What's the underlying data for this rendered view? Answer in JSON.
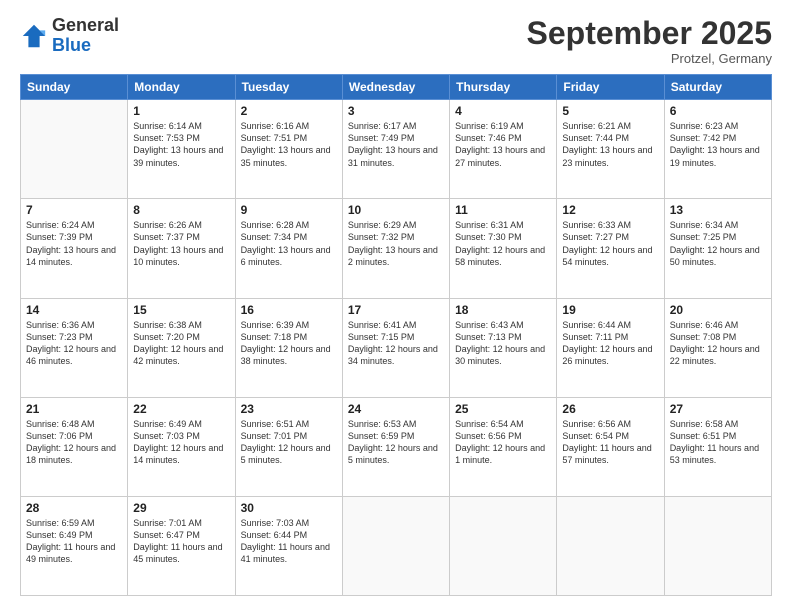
{
  "header": {
    "logo_general": "General",
    "logo_blue": "Blue",
    "month_title": "September 2025",
    "location": "Protzel, Germany"
  },
  "days_of_week": [
    "Sunday",
    "Monday",
    "Tuesday",
    "Wednesday",
    "Thursday",
    "Friday",
    "Saturday"
  ],
  "weeks": [
    [
      {
        "day": "",
        "sunrise": "",
        "sunset": "",
        "daylight": ""
      },
      {
        "day": "1",
        "sunrise": "Sunrise: 6:14 AM",
        "sunset": "Sunset: 7:53 PM",
        "daylight": "Daylight: 13 hours and 39 minutes."
      },
      {
        "day": "2",
        "sunrise": "Sunrise: 6:16 AM",
        "sunset": "Sunset: 7:51 PM",
        "daylight": "Daylight: 13 hours and 35 minutes."
      },
      {
        "day": "3",
        "sunrise": "Sunrise: 6:17 AM",
        "sunset": "Sunset: 7:49 PM",
        "daylight": "Daylight: 13 hours and 31 minutes."
      },
      {
        "day": "4",
        "sunrise": "Sunrise: 6:19 AM",
        "sunset": "Sunset: 7:46 PM",
        "daylight": "Daylight: 13 hours and 27 minutes."
      },
      {
        "day": "5",
        "sunrise": "Sunrise: 6:21 AM",
        "sunset": "Sunset: 7:44 PM",
        "daylight": "Daylight: 13 hours and 23 minutes."
      },
      {
        "day": "6",
        "sunrise": "Sunrise: 6:23 AM",
        "sunset": "Sunset: 7:42 PM",
        "daylight": "Daylight: 13 hours and 19 minutes."
      }
    ],
    [
      {
        "day": "7",
        "sunrise": "Sunrise: 6:24 AM",
        "sunset": "Sunset: 7:39 PM",
        "daylight": "Daylight: 13 hours and 14 minutes."
      },
      {
        "day": "8",
        "sunrise": "Sunrise: 6:26 AM",
        "sunset": "Sunset: 7:37 PM",
        "daylight": "Daylight: 13 hours and 10 minutes."
      },
      {
        "day": "9",
        "sunrise": "Sunrise: 6:28 AM",
        "sunset": "Sunset: 7:34 PM",
        "daylight": "Daylight: 13 hours and 6 minutes."
      },
      {
        "day": "10",
        "sunrise": "Sunrise: 6:29 AM",
        "sunset": "Sunset: 7:32 PM",
        "daylight": "Daylight: 13 hours and 2 minutes."
      },
      {
        "day": "11",
        "sunrise": "Sunrise: 6:31 AM",
        "sunset": "Sunset: 7:30 PM",
        "daylight": "Daylight: 12 hours and 58 minutes."
      },
      {
        "day": "12",
        "sunrise": "Sunrise: 6:33 AM",
        "sunset": "Sunset: 7:27 PM",
        "daylight": "Daylight: 12 hours and 54 minutes."
      },
      {
        "day": "13",
        "sunrise": "Sunrise: 6:34 AM",
        "sunset": "Sunset: 7:25 PM",
        "daylight": "Daylight: 12 hours and 50 minutes."
      }
    ],
    [
      {
        "day": "14",
        "sunrise": "Sunrise: 6:36 AM",
        "sunset": "Sunset: 7:23 PM",
        "daylight": "Daylight: 12 hours and 46 minutes."
      },
      {
        "day": "15",
        "sunrise": "Sunrise: 6:38 AM",
        "sunset": "Sunset: 7:20 PM",
        "daylight": "Daylight: 12 hours and 42 minutes."
      },
      {
        "day": "16",
        "sunrise": "Sunrise: 6:39 AM",
        "sunset": "Sunset: 7:18 PM",
        "daylight": "Daylight: 12 hours and 38 minutes."
      },
      {
        "day": "17",
        "sunrise": "Sunrise: 6:41 AM",
        "sunset": "Sunset: 7:15 PM",
        "daylight": "Daylight: 12 hours and 34 minutes."
      },
      {
        "day": "18",
        "sunrise": "Sunrise: 6:43 AM",
        "sunset": "Sunset: 7:13 PM",
        "daylight": "Daylight: 12 hours and 30 minutes."
      },
      {
        "day": "19",
        "sunrise": "Sunrise: 6:44 AM",
        "sunset": "Sunset: 7:11 PM",
        "daylight": "Daylight: 12 hours and 26 minutes."
      },
      {
        "day": "20",
        "sunrise": "Sunrise: 6:46 AM",
        "sunset": "Sunset: 7:08 PM",
        "daylight": "Daylight: 12 hours and 22 minutes."
      }
    ],
    [
      {
        "day": "21",
        "sunrise": "Sunrise: 6:48 AM",
        "sunset": "Sunset: 7:06 PM",
        "daylight": "Daylight: 12 hours and 18 minutes."
      },
      {
        "day": "22",
        "sunrise": "Sunrise: 6:49 AM",
        "sunset": "Sunset: 7:03 PM",
        "daylight": "Daylight: 12 hours and 14 minutes."
      },
      {
        "day": "23",
        "sunrise": "Sunrise: 6:51 AM",
        "sunset": "Sunset: 7:01 PM",
        "daylight": "Daylight: 12 hours and 5 minutes."
      },
      {
        "day": "24",
        "sunrise": "Sunrise: 6:53 AM",
        "sunset": "Sunset: 6:59 PM",
        "daylight": "Daylight: 12 hours and 5 minutes."
      },
      {
        "day": "25",
        "sunrise": "Sunrise: 6:54 AM",
        "sunset": "Sunset: 6:56 PM",
        "daylight": "Daylight: 12 hours and 1 minute."
      },
      {
        "day": "26",
        "sunrise": "Sunrise: 6:56 AM",
        "sunset": "Sunset: 6:54 PM",
        "daylight": "Daylight: 11 hours and 57 minutes."
      },
      {
        "day": "27",
        "sunrise": "Sunrise: 6:58 AM",
        "sunset": "Sunset: 6:51 PM",
        "daylight": "Daylight: 11 hours and 53 minutes."
      }
    ],
    [
      {
        "day": "28",
        "sunrise": "Sunrise: 6:59 AM",
        "sunset": "Sunset: 6:49 PM",
        "daylight": "Daylight: 11 hours and 49 minutes."
      },
      {
        "day": "29",
        "sunrise": "Sunrise: 7:01 AM",
        "sunset": "Sunset: 6:47 PM",
        "daylight": "Daylight: 11 hours and 45 minutes."
      },
      {
        "day": "30",
        "sunrise": "Sunrise: 7:03 AM",
        "sunset": "Sunset: 6:44 PM",
        "daylight": "Daylight: 11 hours and 41 minutes."
      },
      {
        "day": "",
        "sunrise": "",
        "sunset": "",
        "daylight": ""
      },
      {
        "day": "",
        "sunrise": "",
        "sunset": "",
        "daylight": ""
      },
      {
        "day": "",
        "sunrise": "",
        "sunset": "",
        "daylight": ""
      },
      {
        "day": "",
        "sunrise": "",
        "sunset": "",
        "daylight": ""
      }
    ]
  ]
}
